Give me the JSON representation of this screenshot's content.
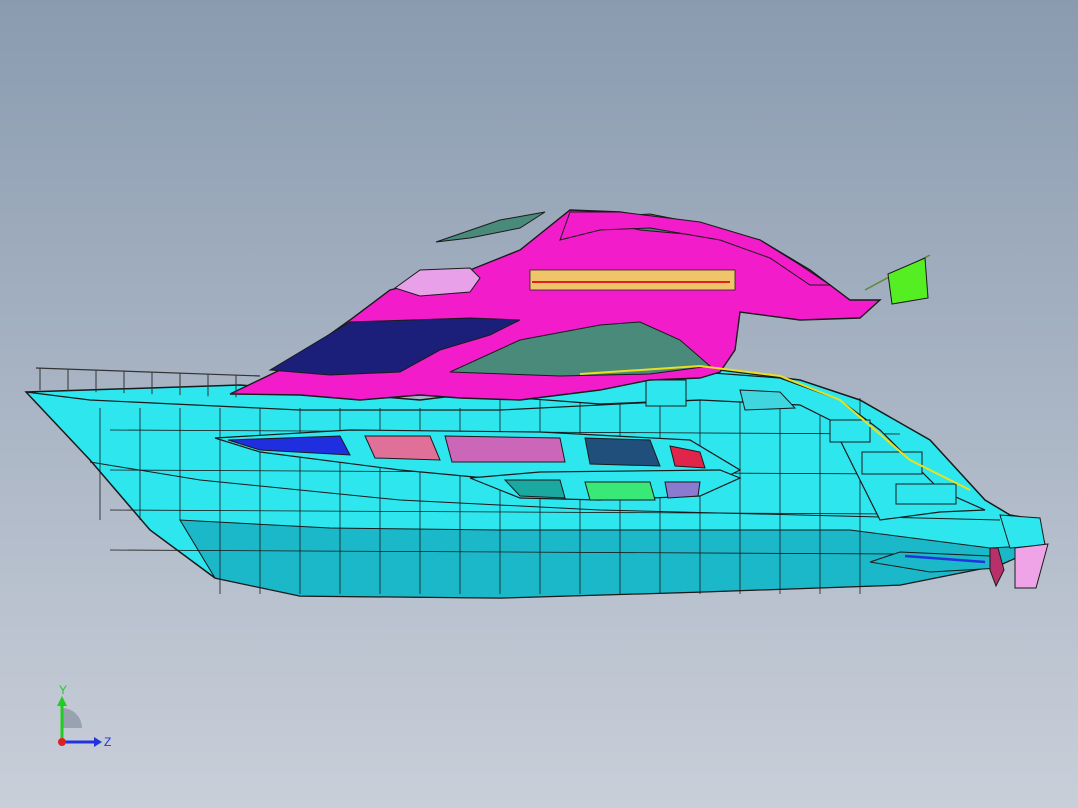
{
  "viewport": {
    "background_top": "#8a9bb0",
    "background_bottom": "#c9cfd9"
  },
  "model": {
    "hull_color": "#2ee6ee",
    "superstructure_color": "#f21ccb",
    "glass_color": "#4a8a7a",
    "windshield_color": "#1c1f7a",
    "flag_color": "#55ee22",
    "stern_color": "#f0a4e8",
    "outline_color": "#1a1a1a",
    "hull_windows": [
      "#1f2fe0",
      "#e07098",
      "#cc66b8",
      "#1f4f7a",
      "#e0244a"
    ],
    "lower_windows": [
      "#3ae878",
      "#8a7ad0"
    ]
  },
  "triad": {
    "y_label": "Y",
    "z_label": "Z",
    "y_color": "#22cc22",
    "z_color": "#2233dd",
    "origin_color": "#dd2222"
  }
}
